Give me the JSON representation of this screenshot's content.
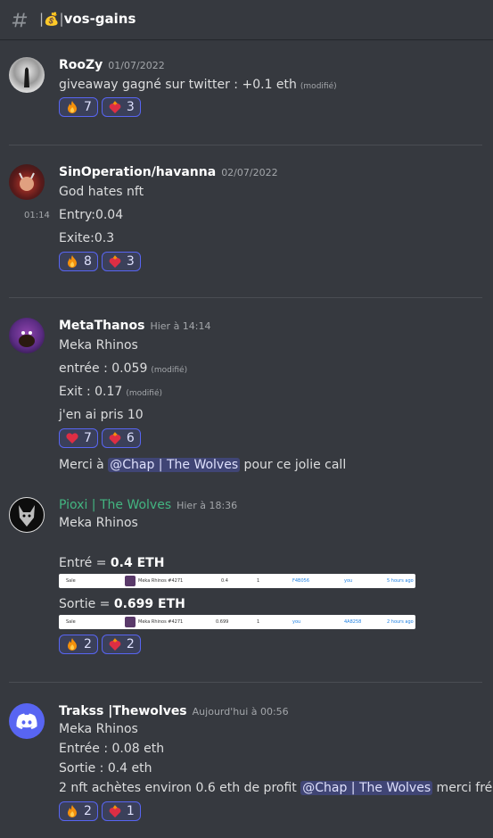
{
  "channel": {
    "name": "vos-gains",
    "emoji": "💰"
  },
  "messages": [
    {
      "author": "RooZy",
      "time": "01/07/2022",
      "lines": [
        {
          "text": "giveaway gagné sur twitter : +0.1 eth",
          "edited": "(modifié)"
        }
      ],
      "reactions": [
        {
          "emoji": "fire",
          "count": "7"
        },
        {
          "emoji": "fire-heart",
          "count": "3"
        }
      ]
    },
    {
      "author": "SinOperation/havanna",
      "time": "02/07/2022",
      "hover_time": "01:14",
      "lines": [
        {
          "text": "God hates nft"
        },
        {
          "text": "Entry:0.04"
        },
        {
          "text": "Exite:0.3"
        }
      ],
      "reactions": [
        {
          "emoji": "fire",
          "count": "8"
        },
        {
          "emoji": "fire-heart",
          "count": "3"
        }
      ]
    },
    {
      "author": "MetaThanos",
      "time": "Hier à 14:14",
      "lines": [
        {
          "text": "Meka Rhinos"
        },
        {
          "text": "entrée : 0.059",
          "edited": "(modifié)"
        },
        {
          "text": "Exit : 0.17",
          "edited": "(modifié)"
        },
        {
          "text": "j'en ai pris 10"
        }
      ],
      "reactions": [
        {
          "emoji": "heart",
          "count": "7"
        },
        {
          "emoji": "fire-heart",
          "count": "6"
        }
      ],
      "followup": {
        "before": "Merci à ",
        "mention": "@Chap | The Wolves",
        "after": " pour ce jolie call"
      }
    },
    {
      "author": "Pioxi | The Wolves",
      "author_color": "#43b581",
      "time": "Hier à 18:36",
      "lines": [
        {
          "text": "Meka Rhinos"
        }
      ],
      "entry": {
        "label": "Entré = ",
        "value": "0.4 ETH"
      },
      "exit": {
        "label": "Sortie = ",
        "value": "0.699 ETH"
      },
      "strip1": {
        "type": "Sale",
        "collection": "Meka Rhinos",
        "item": "Meka Rhinos #4271",
        "price": "0.4",
        "usd": "$433.56",
        "qty": "1",
        "from": "F4B056",
        "to": "you",
        "age": "5 hours ago"
      },
      "strip2": {
        "type": "Sale",
        "collection": "Meka Rhinos",
        "item": "Meka Rhinos #4271",
        "price": "0.699",
        "usd": "$756.73",
        "qty": "1",
        "from": "you",
        "to": "4A8258",
        "age": "2 hours ago"
      },
      "reactions": [
        {
          "emoji": "fire",
          "count": "2"
        },
        {
          "emoji": "fire-heart",
          "count": "2"
        }
      ]
    },
    {
      "author": "Trakss |Thewolves",
      "time": "Aujourd'hui à 00:56",
      "lines": [
        {
          "text": "Meka Rhinos"
        },
        {
          "text": "Entrée : 0.08 eth"
        },
        {
          "text": "Sortie : 0.4 eth"
        }
      ],
      "profit": {
        "before": "2 nft achètes environ 0.6 eth de profit ",
        "mention": "@Chap | The Wolves",
        "after": " merci frérot"
      },
      "reactions": [
        {
          "emoji": "fire",
          "count": "2"
        },
        {
          "emoji": "fire-heart",
          "count": "1"
        }
      ]
    }
  ],
  "colors": {
    "background": "#36393f",
    "accent": "#5865f2",
    "mention_bg": "#4752c4",
    "green_name": "#43b581"
  }
}
